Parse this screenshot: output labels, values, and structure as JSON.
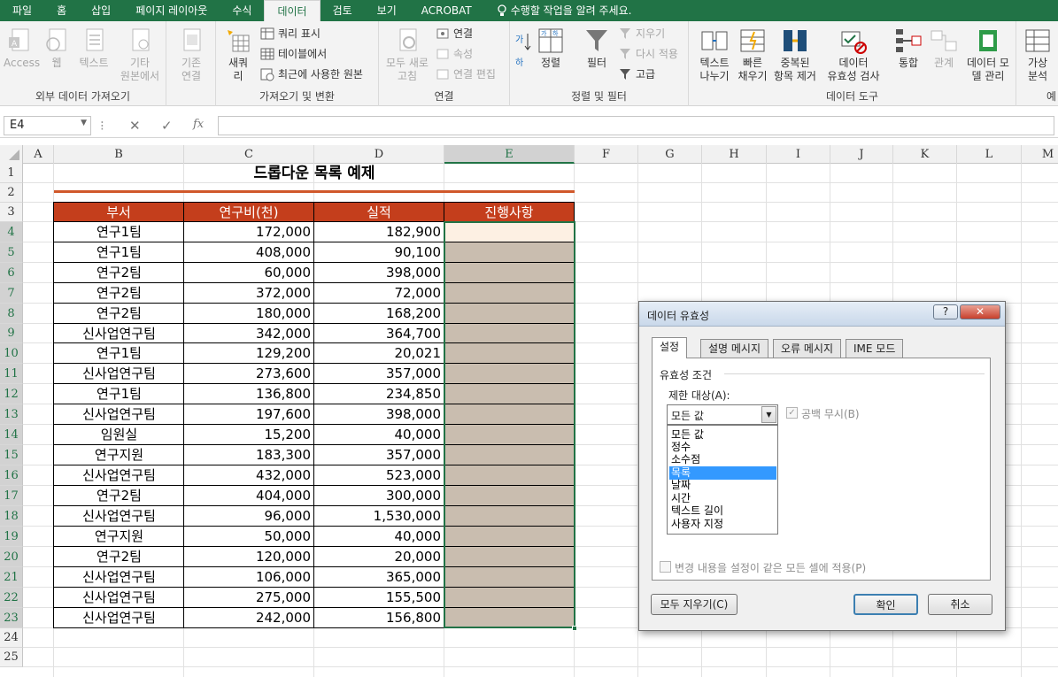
{
  "ribbon_tabs": [
    "파일",
    "홈",
    "삽입",
    "페이지 레이아웃",
    "수식",
    "데이터",
    "검토",
    "보기",
    "ACROBAT"
  ],
  "tell_me": "수행할 작업을 알려 주세요.",
  "groups": {
    "external": {
      "label": "외부 데이터 가져오기",
      "access": "Access",
      "web": "웹",
      "text": "텍스트",
      "other1": "기타",
      "other2": "원본에서",
      "existing1": "기존",
      "existing2": "연결"
    },
    "transform": {
      "label": "가져오기 및 변환",
      "newq1": "새쿼",
      "newq2": "리",
      "show_query": "쿼리 표시",
      "from_table": "테이블에서",
      "recent": "최근에 사용한 원본"
    },
    "connections": {
      "label": "연결",
      "refresh1": "모두 새로",
      "refresh2": "고침",
      "connections": "연결",
      "properties": "속성",
      "edit_links": "연결 편집"
    },
    "sort": {
      "label": "정렬 및 필터",
      "sort": "정렬",
      "filter": "필터",
      "clear": "지우기",
      "reapply": "다시 적용",
      "advanced": "고급"
    },
    "tools": {
      "label": "데이터 도구",
      "t2c1": "텍스트",
      "t2c2": "나누기",
      "flash1": "빠른",
      "flash2": "채우기",
      "dup1": "중복된",
      "dup2": "항목 제거",
      "valid1": "데이터",
      "valid2": "유효성 검사",
      "consol": "통합",
      "rel": "관계",
      "model1": "데이터 모",
      "model2": "델 관리"
    },
    "forecast": {
      "whatif1": "가상",
      "whatif2": "분석",
      "trunc": "예"
    }
  },
  "namebox": "E4",
  "columns": [
    "A",
    "B",
    "C",
    "D",
    "E",
    "F",
    "G",
    "H",
    "I",
    "J",
    "K",
    "L",
    "M"
  ],
  "rows": [
    "1",
    "2",
    "3",
    "4",
    "5",
    "6",
    "7",
    "8",
    "9",
    "10",
    "11",
    "12",
    "13",
    "14",
    "15",
    "16",
    "17",
    "18",
    "19",
    "20",
    "21",
    "22",
    "23",
    "24",
    "25"
  ],
  "sheet_title": "드롭다운 목록 예제",
  "headers": [
    "부서",
    "연구비(천)",
    "실적",
    "진행사항"
  ],
  "table": [
    [
      "연구1팀",
      "172,000",
      "182,900"
    ],
    [
      "연구1팀",
      "408,000",
      "90,100"
    ],
    [
      "연구2팀",
      "60,000",
      "398,000"
    ],
    [
      "연구2팀",
      "372,000",
      "72,000"
    ],
    [
      "연구2팀",
      "180,000",
      "168,200"
    ],
    [
      "신사업연구팀",
      "342,000",
      "364,700"
    ],
    [
      "연구1팀",
      "129,200",
      "20,021"
    ],
    [
      "신사업연구팀",
      "273,600",
      "357,000"
    ],
    [
      "연구1팀",
      "136,800",
      "234,850"
    ],
    [
      "신사업연구팀",
      "197,600",
      "398,000"
    ],
    [
      "임원실",
      "15,200",
      "40,000"
    ],
    [
      "연구지원",
      "183,300",
      "357,000"
    ],
    [
      "신사업연구팀",
      "432,000",
      "523,000"
    ],
    [
      "연구2팀",
      "404,000",
      "300,000"
    ],
    [
      "신사업연구팀",
      "96,000",
      "1,530,000"
    ],
    [
      "연구지원",
      "50,000",
      "40,000"
    ],
    [
      "연구2팀",
      "120,000",
      "20,000"
    ],
    [
      "신사업연구팀",
      "106,000",
      "365,000"
    ],
    [
      "신사업연구팀",
      "275,000",
      "155,500"
    ],
    [
      "신사업연구팀",
      "242,000",
      "156,800"
    ]
  ],
  "dialog": {
    "title": "데이터 유효성",
    "help": "?",
    "close": "✕",
    "tabs": [
      "설정",
      "설명 메시지",
      "오류 메시지",
      "IME 모드"
    ],
    "section": "유효성 조건",
    "allow_label": "제한 대상(A):",
    "allow_value": "모든 값",
    "ignore_blank": "공백 무시(B)",
    "list_options": [
      "모든 값",
      "정수",
      "소수점",
      "목록",
      "날짜",
      "시간",
      "텍스트 길이",
      "사용자 지정"
    ],
    "selected_option": "목록",
    "apply_all": "변경 내용을 설정이 같은 모든 셀에 적용(P)",
    "clear_all": "모두 지우기(C)",
    "ok": "확인",
    "cancel": "취소"
  },
  "colors": {
    "ribbon_green": "#217346",
    "header_fill": "#c43e1c",
    "e_fill": "#c9bdaf",
    "highlight": "#e0151e",
    "title_underline": "#d0582a"
  }
}
